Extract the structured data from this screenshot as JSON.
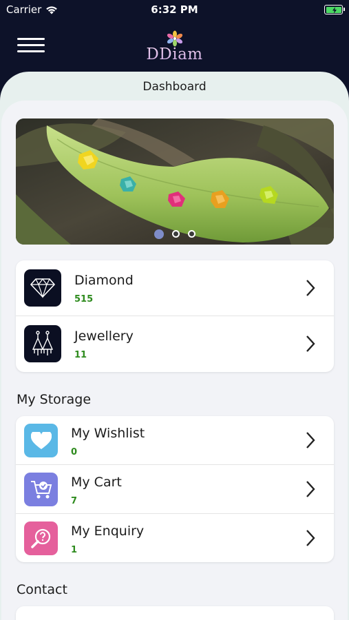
{
  "status_bar": {
    "carrier": "Carrier",
    "time": "6:32 PM"
  },
  "header": {
    "brand": "DDiam"
  },
  "page": {
    "title": "Dashboard"
  },
  "banner": {
    "slide_count": 3,
    "active_slide": 0
  },
  "categories": [
    {
      "title": "Diamond",
      "count": "515",
      "icon": "diamond-icon"
    },
    {
      "title": "Jewellery",
      "count": "11",
      "icon": "earrings-icon"
    }
  ],
  "storage": {
    "title": "My Storage",
    "items": [
      {
        "title": "My Wishlist",
        "count": "0",
        "icon": "heart-icon",
        "color": "#5ab8e6"
      },
      {
        "title": "My Cart",
        "count": "7",
        "icon": "cart-icon",
        "color": "#7b7fe0"
      },
      {
        "title": "My Enquiry",
        "count": "1",
        "icon": "enquiry-icon",
        "color": "#e5609c"
      }
    ]
  },
  "contact": {
    "title": "Contact"
  },
  "colors": {
    "count_green": "#2e8b1e",
    "header_bg": "#0d1229",
    "panel_bg": "#f2f3f7"
  }
}
